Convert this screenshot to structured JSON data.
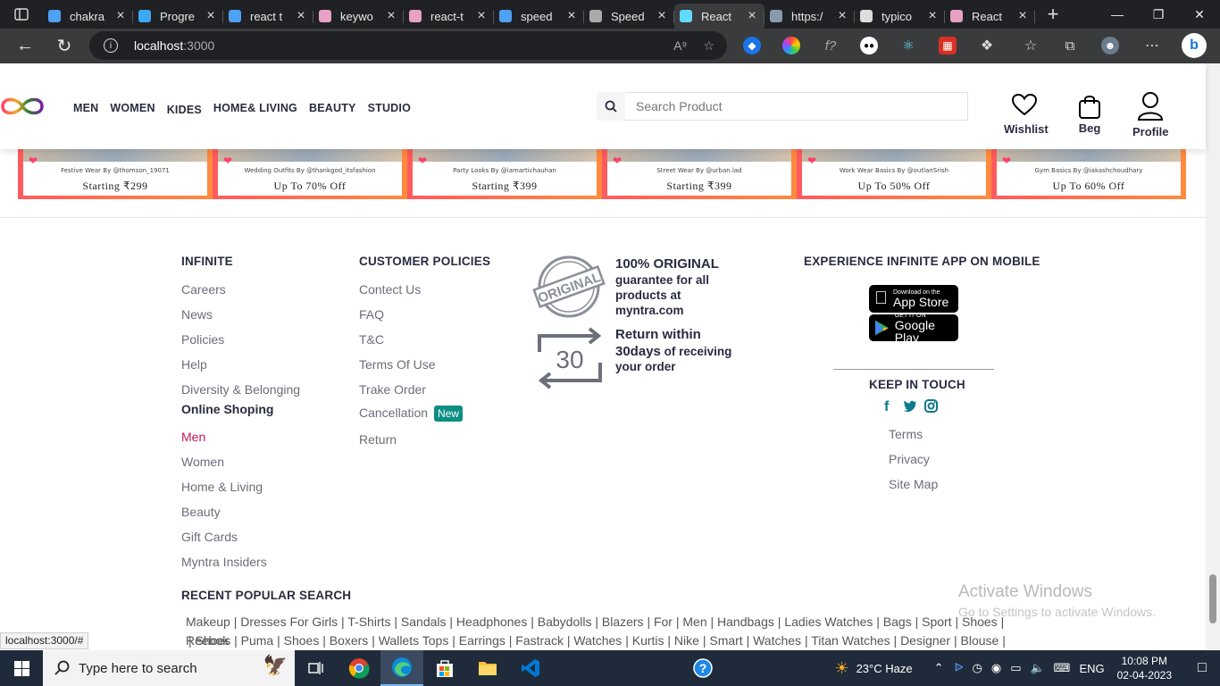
{
  "browser": {
    "tabs": [
      {
        "title": "chakra",
        "color": "#4ea1f5"
      },
      {
        "title": "Progre",
        "color": "#3da8f5"
      },
      {
        "title": "react t",
        "color": "#4ea1f5"
      },
      {
        "title": "keywo",
        "color": "#e8a0c5"
      },
      {
        "title": "react-t",
        "color": "#e8a0c5"
      },
      {
        "title": "speed",
        "color": "#4ea1f5"
      },
      {
        "title": "Speed",
        "color": "#aaaaaa"
      },
      {
        "title": "React",
        "color": "#61dafb"
      },
      {
        "title": "https:/",
        "color": "#8899aa"
      },
      {
        "title": "typico",
        "color": "#dddddd"
      },
      {
        "title": "React",
        "color": "#e8a0c5"
      }
    ],
    "active_tab": 7,
    "url_host": "localhost",
    "url_port": ":3000",
    "status_url": "localhost:3000/#"
  },
  "header": {
    "nav": [
      "MEN",
      "WOMEN",
      "KIDES",
      "HOME& LIVING",
      "BEAUTY",
      "STUDIO"
    ],
    "search_placeholder": "Search Product",
    "wishlist": "Wishlist",
    "bag": "Beg",
    "profile": "Profile"
  },
  "banner": {
    "cards": [
      {
        "caption": "Festive Wear By @thomson_19071",
        "offer": "Starting ₹299"
      },
      {
        "caption": "Wedding Outfits By @thankgod_itsfashion",
        "offer": "Up To 70% Off"
      },
      {
        "caption": "Party Looks By @iamartichauhan",
        "offer": "Starting ₹399"
      },
      {
        "caption": "Street Wear By @urban.lad",
        "offer": "Starting ₹399"
      },
      {
        "caption": "Work Wear Basics By @outlanSrish",
        "offer": "Up To 50% Off"
      },
      {
        "caption": "Gym Basics By @iakashchoudhary",
        "offer": "Up To 60% Off"
      }
    ]
  },
  "footer": {
    "col1": {
      "heading": "INFINITE",
      "links": [
        "Careers",
        "News",
        "Policies",
        "Help",
        "Diversity & Belonging"
      ],
      "subheading": "Online Shoping",
      "shop_links": [
        "Men",
        "Women",
        "Home & Living",
        "Beauty",
        "Gift Cards",
        "Myntra Insiders"
      ]
    },
    "col2": {
      "heading": "CUSTOMER POLICIES",
      "links": [
        "Contect Us",
        "FAQ",
        "T&C",
        "Terms Of Use",
        "Trake Order",
        "Cancellation",
        "Return"
      ],
      "new_badge": "New"
    },
    "promo": {
      "seal_text": "ORIGINAL",
      "original_title": "100% ORIGINAL",
      "original_text": "guarantee for all products at myntra.com",
      "return_icon_text": "30",
      "return_title": "Return within",
      "return_days": "30days",
      "return_text": "of receiving your order"
    },
    "app": {
      "heading": "EXPERIENCE INFINITE APP ON MOBILE",
      "appstore_small": "Download on the",
      "appstore_large": "App Store",
      "playstore_small": "GET IT ON",
      "playstore_large": "Google Play",
      "keep_in_touch": "KEEP IN TOUCH",
      "social_icons": [
        "facebook-icon",
        "twitter-icon",
        "instagram-icon"
      ],
      "links": [
        "Terms",
        "Privacy",
        "Site Map"
      ]
    },
    "recent": {
      "heading": "RECENT POPULAR SEARCH",
      "line1": "Makeup | Dresses For Girls | T-Shirts | Sandals | Headphones | Babydolls | Blazers | For | Men | Handbags | Ladies Watches | Bags | Sport | Shoes | Reebok",
      "line2": "| Shoes | Puma | Shoes | Boxers | Wallets Tops | Earrings | Fastrack | Watches | Kurtis | Nike | Smart | Watches | Titan Watches | Designer | Blouse | Gowns |"
    }
  },
  "watermark": {
    "line1": "Activate Windows",
    "line2": "Go to Settings to activate Windows."
  },
  "taskbar": {
    "search_placeholder": "Type here to search",
    "weather": "23°C  Haze",
    "lang": "ENG",
    "time": "10:08 PM",
    "date": "02-04-2023"
  },
  "colors": {
    "brand_pink": "#c2185b",
    "badge_teal": "#0b8e84",
    "banner_gradient_start": "#ff5a5f",
    "banner_gradient_end": "#ff8a3d"
  }
}
